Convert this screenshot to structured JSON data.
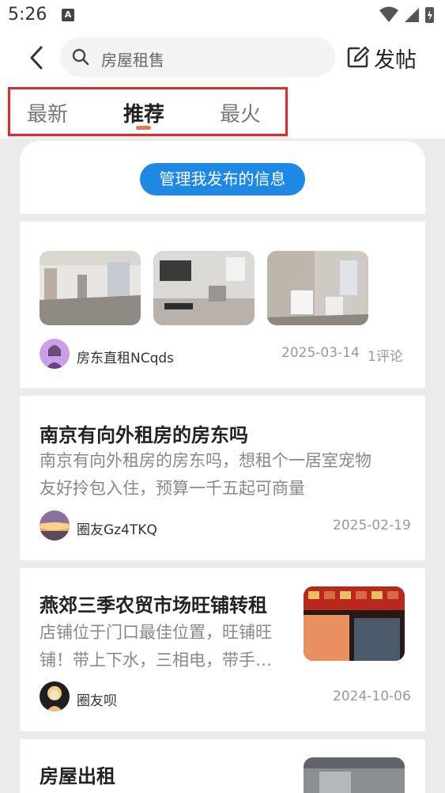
{
  "status_bar": {
    "time": "5:26",
    "notification_icon": "A"
  },
  "header": {
    "search_placeholder": "房屋租售",
    "post_label": "发帖"
  },
  "tabs": [
    {
      "label": "最新"
    },
    {
      "label": "推荐"
    },
    {
      "label": "最火"
    }
  ],
  "active_tab": "推荐",
  "manage_button": "管理我发布的信息",
  "posts": [
    {
      "author": "房东直租NCqds",
      "date": "2025-03-14",
      "comments": "1评论"
    },
    {
      "title": "南京有向外租房的房东吗",
      "excerpt_line1": "南京有向外租房的房东吗，想租个一居室宠物",
      "excerpt_line2": "友好拎包入住，预算一千五起可商量",
      "author": "圈友Gz4TKQ",
      "date": "2025-02-19"
    },
    {
      "title": "燕郊三季农贸市场旺铺转租",
      "excerpt_line1": "店铺位于门口最佳位置，旺铺旺",
      "excerpt_line2": "铺！带上下水，三相电，带手…",
      "author": "圈友呗",
      "date": "2024-10-06"
    },
    {
      "title": "房屋出租"
    }
  ],
  "colors": {
    "accent_blue": "#1e88e5",
    "tab_underline": "#e07a5a",
    "highlight_box": "#d32f2f"
  }
}
